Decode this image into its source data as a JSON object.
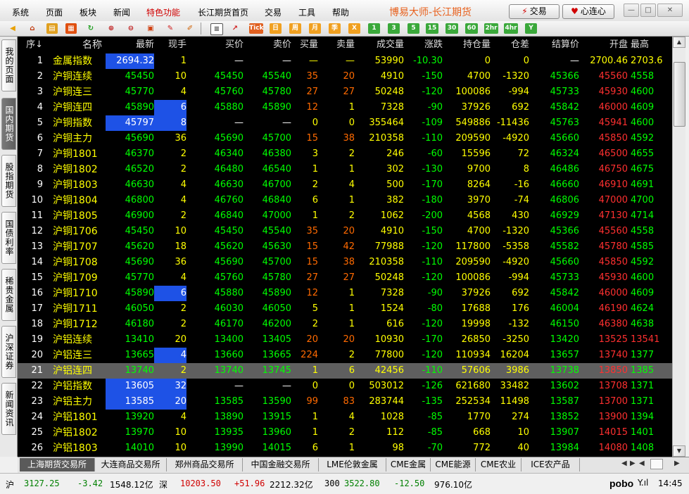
{
  "menu": {
    "items": [
      "系统",
      "页面",
      "板块",
      "新闻",
      "特色功能",
      "长江期货首页",
      "交易",
      "工具",
      "帮助"
    ],
    "app_title": "博易大师-长江期货",
    "trade_btn": "交易",
    "connect_btn": "心连心"
  },
  "toolbar": {
    "labels": [
      "Tick",
      "日",
      "周",
      "月",
      "季",
      "X",
      "1",
      "3",
      "5",
      "15",
      "30",
      "60",
      "2hr",
      "4hr",
      "Y"
    ]
  },
  "sidebar": {
    "tabs": [
      "我的页面",
      "国内期货",
      "股指期货",
      "国债利率",
      "稀贵金属",
      "沪深证券",
      "新闻资讯"
    ],
    "active": "国内期货"
  },
  "table": {
    "headers": {
      "idx": "序↓",
      "name": "名称",
      "last": "最新",
      "vol": "现手",
      "bid": "买价",
      "ask": "卖价",
      "bidvol": "买量",
      "askvol": "卖量",
      "tvol": "成交量",
      "chg": "涨跌",
      "oi": "持仓量",
      "doi": "仓差",
      "settle": "结算价",
      "open": "开盘",
      "high": "最高"
    },
    "rows": [
      [
        "1",
        "金属指数",
        "2694.32",
        "1",
        "—",
        "—",
        "—",
        "—",
        "53990",
        "-10.30",
        "0",
        "0",
        "—",
        "2700.46",
        "2703.6"
      ],
      [
        "2",
        "沪铜连续",
        "45450",
        "10",
        "45450",
        "45540",
        "35",
        "20",
        "4910",
        "-150",
        "4700",
        "-1320",
        "45366",
        "45560",
        "4558"
      ],
      [
        "3",
        "沪铜连三",
        "45770",
        "4",
        "45760",
        "45780",
        "27",
        "27",
        "50248",
        "-120",
        "100086",
        "-994",
        "45733",
        "45930",
        "4600"
      ],
      [
        "4",
        "沪铜连四",
        "45890",
        "6",
        "45880",
        "45890",
        "12",
        "1",
        "7328",
        "-90",
        "37926",
        "692",
        "45842",
        "46000",
        "4609"
      ],
      [
        "5",
        "沪铜指数",
        "45797",
        "8",
        "—",
        "—",
        "0",
        "0",
        "355464",
        "-109",
        "549886",
        "-11436",
        "45763",
        "45941",
        "4600"
      ],
      [
        "6",
        "沪铜主力",
        "45690",
        "36",
        "45690",
        "45700",
        "15",
        "38",
        "210358",
        "-110",
        "209590",
        "-4920",
        "45660",
        "45850",
        "4592"
      ],
      [
        "7",
        "沪铜1801",
        "46370",
        "2",
        "46340",
        "46380",
        "3",
        "2",
        "246",
        "-60",
        "15596",
        "72",
        "46324",
        "46500",
        "4655"
      ],
      [
        "8",
        "沪铜1802",
        "46520",
        "2",
        "46480",
        "46540",
        "1",
        "1",
        "302",
        "-130",
        "9700",
        "8",
        "46486",
        "46750",
        "4675"
      ],
      [
        "9",
        "沪铜1803",
        "46630",
        "4",
        "46630",
        "46700",
        "2",
        "4",
        "500",
        "-170",
        "8264",
        "-16",
        "46660",
        "46910",
        "4691"
      ],
      [
        "10",
        "沪铜1804",
        "46800",
        "4",
        "46760",
        "46840",
        "6",
        "1",
        "382",
        "-180",
        "3970",
        "-74",
        "46806",
        "47000",
        "4700"
      ],
      [
        "11",
        "沪铜1805",
        "46900",
        "2",
        "46840",
        "47000",
        "1",
        "2",
        "1062",
        "-200",
        "4568",
        "430",
        "46929",
        "47130",
        "4714"
      ],
      [
        "12",
        "沪铜1706",
        "45450",
        "10",
        "45450",
        "45540",
        "35",
        "20",
        "4910",
        "-150",
        "4700",
        "-1320",
        "45366",
        "45560",
        "4558"
      ],
      [
        "13",
        "沪铜1707",
        "45620",
        "18",
        "45620",
        "45630",
        "15",
        "42",
        "77988",
        "-120",
        "117800",
        "-5358",
        "45582",
        "45780",
        "4585"
      ],
      [
        "14",
        "沪铜1708",
        "45690",
        "36",
        "45690",
        "45700",
        "15",
        "38",
        "210358",
        "-110",
        "209590",
        "-4920",
        "45660",
        "45850",
        "4592"
      ],
      [
        "15",
        "沪铜1709",
        "45770",
        "4",
        "45760",
        "45780",
        "27",
        "27",
        "50248",
        "-120",
        "100086",
        "-994",
        "45733",
        "45930",
        "4600"
      ],
      [
        "16",
        "沪铜1710",
        "45890",
        "6",
        "45880",
        "45890",
        "12",
        "1",
        "7328",
        "-90",
        "37926",
        "692",
        "45842",
        "46000",
        "4609"
      ],
      [
        "17",
        "沪铜1711",
        "46050",
        "2",
        "46030",
        "46050",
        "5",
        "1",
        "1524",
        "-80",
        "17688",
        "176",
        "46004",
        "46190",
        "4624"
      ],
      [
        "18",
        "沪铜1712",
        "46180",
        "2",
        "46170",
        "46200",
        "2",
        "1",
        "616",
        "-120",
        "19998",
        "-132",
        "46150",
        "46380",
        "4638"
      ],
      [
        "19",
        "沪铝连续",
        "13410",
        "20",
        "13400",
        "13405",
        "20",
        "20",
        "10930",
        "-170",
        "26850",
        "-3250",
        "13420",
        "13525",
        "13541"
      ],
      [
        "20",
        "沪铝连三",
        "13665",
        "4",
        "13660",
        "13665",
        "224",
        "2",
        "77800",
        "-120",
        "110934",
        "16204",
        "13657",
        "13740",
        "1377"
      ],
      [
        "21",
        "沪铝连四",
        "13740",
        "2",
        "13740",
        "13745",
        "1",
        "6",
        "42456",
        "-110",
        "57606",
        "3986",
        "13738",
        "13850",
        "1385"
      ],
      [
        "22",
        "沪铝指数",
        "13605",
        "32",
        "—",
        "—",
        "0",
        "0",
        "503012",
        "-126",
        "621680",
        "33482",
        "13602",
        "13708",
        "1371"
      ],
      [
        "23",
        "沪铝主力",
        "13585",
        "20",
        "13585",
        "13590",
        "99",
        "83",
        "283744",
        "-135",
        "252534",
        "11498",
        "13587",
        "13700",
        "1371"
      ],
      [
        "24",
        "沪铝1801",
        "13920",
        "4",
        "13890",
        "13915",
        "1",
        "4",
        "1028",
        "-85",
        "1770",
        "274",
        "13852",
        "13900",
        "1394"
      ],
      [
        "25",
        "沪铝1802",
        "13970",
        "10",
        "13935",
        "13960",
        "1",
        "2",
        "112",
        "-85",
        "668",
        "10",
        "13907",
        "14015",
        "1401"
      ],
      [
        "26",
        "沪铝1803",
        "14010",
        "10",
        "13990",
        "14015",
        "6",
        "1",
        "98",
        "-70",
        "772",
        "40",
        "13984",
        "14080",
        "1408"
      ]
    ],
    "selected_row": 21
  },
  "exchange_tabs": [
    "上海期货交易所",
    "大连商品交易所",
    "郑州商品交易所",
    "中国金融交易所",
    "LME伦敦金属",
    "CME金属",
    "CME能源",
    "CME农业",
    "ICE农产品"
  ],
  "status": {
    "sh_label": "沪",
    "sh_index": "3127.25",
    "sh_chg": "-3.42",
    "sh_amt": "1548.12亿",
    "sz_label": "深",
    "sz_index": "10203.50",
    "sz_chg": "+51.96",
    "sz_amt": "2212.32亿",
    "hs_label": "300",
    "hs_index": "3522.80",
    "hs_chg": "-12.50",
    "hs_amt": "976.10亿",
    "brand": "pobo",
    "time": "14:45"
  }
}
